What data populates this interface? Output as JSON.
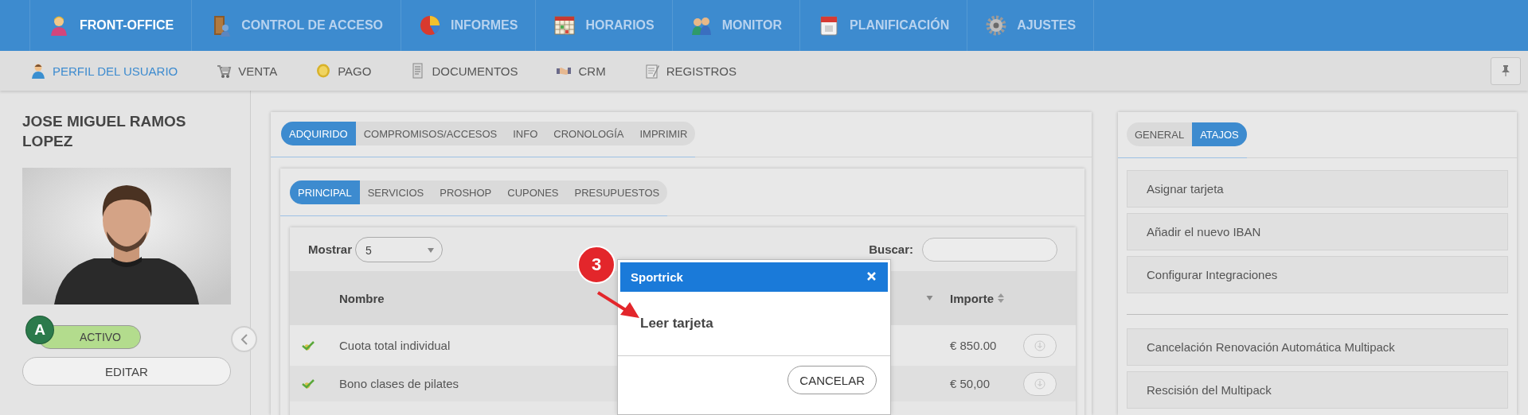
{
  "top_nav": {
    "items": [
      {
        "label": "FRONT-OFFICE",
        "selected": true
      },
      {
        "label": "CONTROL DE ACCESO",
        "selected": false
      },
      {
        "label": "INFORMES",
        "selected": false
      },
      {
        "label": "HORARIOS",
        "selected": false
      },
      {
        "label": "MONITOR",
        "selected": false
      },
      {
        "label": "PLANIFICACIÓN",
        "selected": false
      },
      {
        "label": "AJUSTES",
        "selected": false
      }
    ]
  },
  "sub_nav": {
    "items": [
      {
        "label": "PERFIL DEL USUARIO",
        "selected": true
      },
      {
        "label": "VENTA",
        "selected": false
      },
      {
        "label": "PAGO",
        "selected": false
      },
      {
        "label": "DOCUMENTOS",
        "selected": false
      },
      {
        "label": "CRM",
        "selected": false
      },
      {
        "label": "REGISTROS",
        "selected": false
      }
    ]
  },
  "user": {
    "name": "JOSE MIGUEL RAMOS LOPEZ",
    "avatar_letter": "A",
    "status": "ACTIVO",
    "edit_button": "EDITAR"
  },
  "main_tabs": [
    {
      "label": "ADQUIRIDO",
      "selected": true
    },
    {
      "label": "COMPROMISOS/ACCESOS",
      "selected": false
    },
    {
      "label": "INFO",
      "selected": false
    },
    {
      "label": "CRONOLOGÍA",
      "selected": false
    },
    {
      "label": "IMPRIMIR",
      "selected": false
    }
  ],
  "sub_tabs": [
    {
      "label": "PRINCIPAL",
      "selected": true
    },
    {
      "label": "SERVICIOS",
      "selected": false
    },
    {
      "label": "PROSHOP",
      "selected": false
    },
    {
      "label": "CUPONES",
      "selected": false
    },
    {
      "label": "PRESUPUESTOS",
      "selected": false
    }
  ],
  "table": {
    "length_label": "Mostrar",
    "length_value": "5",
    "search_label": "Buscar:",
    "columns": [
      {
        "label": "Nombre",
        "sortable": false
      },
      {
        "label": "Importe",
        "sortable": true
      }
    ],
    "rows": [
      {
        "nombre": "Cuota total individual",
        "importe": "€ 850.00"
      },
      {
        "nombre": "Bono clases de pilates",
        "importe": "€ 50,00"
      }
    ]
  },
  "dialog": {
    "title": "Sportrick",
    "message": "Leer tarjeta",
    "cancel_button": "CANCELAR",
    "step_badge": "3"
  },
  "shortcuts": {
    "tabs": [
      {
        "label": "GENERAL",
        "selected": false
      },
      {
        "label": "ATAJOS",
        "selected": true
      }
    ],
    "groups": [
      [
        "Asignar tarjeta",
        "Añadir el nuevo IBAN",
        "Configurar Integraciones"
      ],
      [
        "Cancelación Renovación Automática Multipack",
        "Rescisión del Multipack"
      ]
    ]
  }
}
